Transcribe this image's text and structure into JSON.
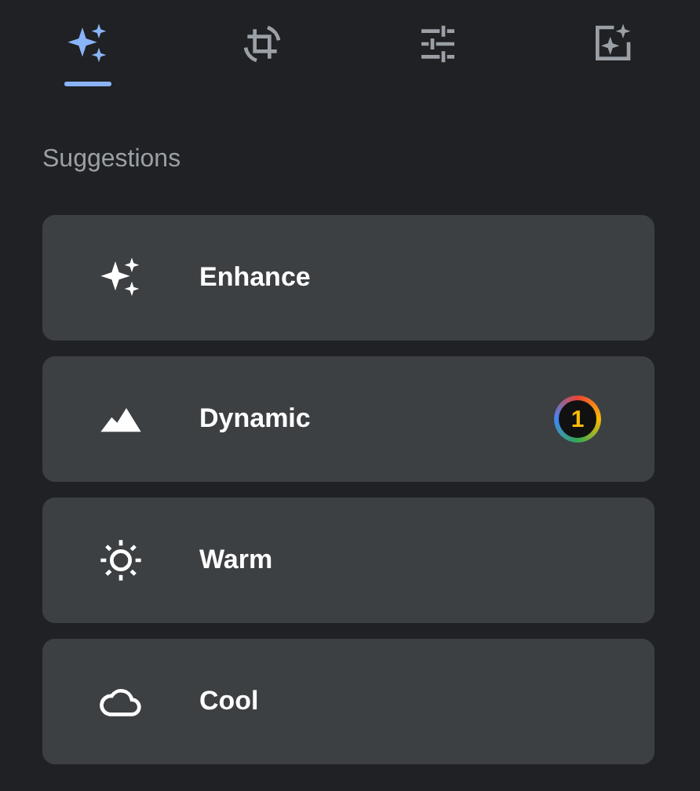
{
  "tabs": [
    {
      "kind": "sparkle",
      "selected": true
    },
    {
      "kind": "crop",
      "selected": false
    },
    {
      "kind": "adjust",
      "selected": false
    },
    {
      "kind": "markup",
      "selected": false
    }
  ],
  "section_title": "Suggestions",
  "suggestions": [
    {
      "kind": "enhance",
      "label": "Enhance"
    },
    {
      "kind": "dynamic",
      "label": "Dynamic",
      "badge": "1"
    },
    {
      "kind": "warm",
      "label": "Warm"
    },
    {
      "kind": "cool",
      "label": "Cool"
    }
  ]
}
